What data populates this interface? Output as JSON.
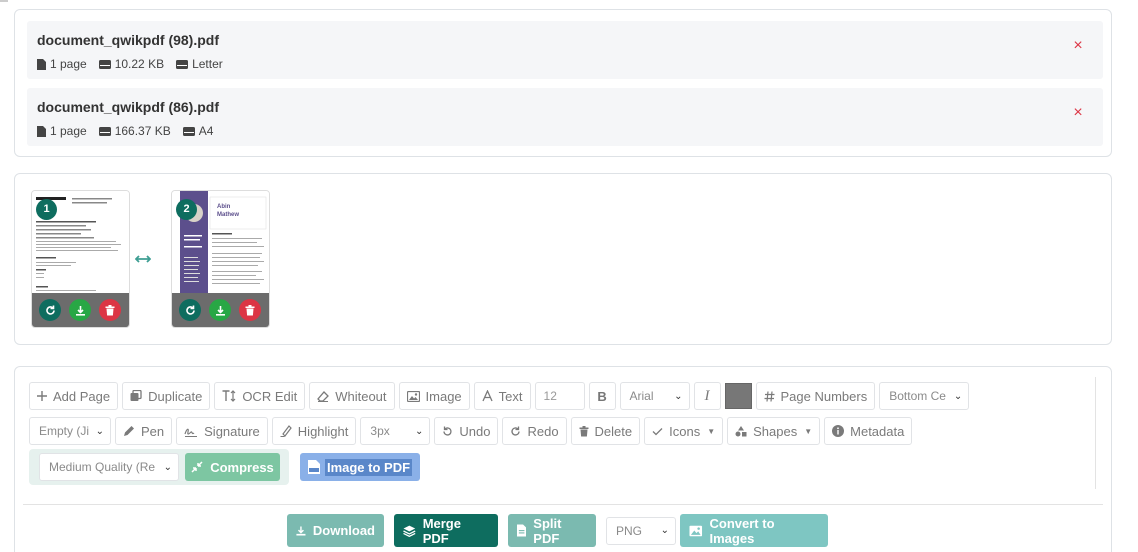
{
  "files": [
    {
      "name": "document_qwikpdf (98).pdf",
      "pages": "1 page",
      "size": "10.22 KB",
      "format": "Letter"
    },
    {
      "name": "document_qwikpdf (86).pdf",
      "pages": "1 page",
      "size": "166.37 KB",
      "format": "A4"
    }
  ],
  "remove_glyph": "×",
  "pages": [
    {
      "number": "1"
    },
    {
      "number": "2",
      "preview_first_name": "Abin",
      "preview_last_name": "Mathew"
    }
  ],
  "toolbar": {
    "add_page": "Add Page",
    "duplicate": "Duplicate",
    "ocr_edit": "OCR Edit",
    "whiteout": "Whiteout",
    "image": "Image",
    "text": "Text",
    "font_size": "12",
    "bold": "B",
    "font": "Arial",
    "italic": "I",
    "page_numbers": "Page Numbers",
    "page_number_position": "Bottom Ce",
    "empty_select": "Empty (Ji",
    "pen": "Pen",
    "signature": "Signature",
    "highlight": "Highlight",
    "stroke_width": "3px",
    "undo": "Undo",
    "redo": "Redo",
    "delete": "Delete",
    "icons": "Icons",
    "shapes": "Shapes",
    "metadata": "Metadata",
    "quality": "Medium Quality (Re",
    "compress": "Compress",
    "image_to_pdf": "Image to PDF"
  },
  "actions": {
    "download": "Download",
    "merge": "Merge PDF",
    "split": "Split PDF",
    "format": "PNG",
    "convert": "Convert to Images"
  },
  "colors": {
    "accent": "#0e6d5f",
    "success": "#28a745",
    "danger": "#dc3545",
    "draw_color": "#777777"
  }
}
